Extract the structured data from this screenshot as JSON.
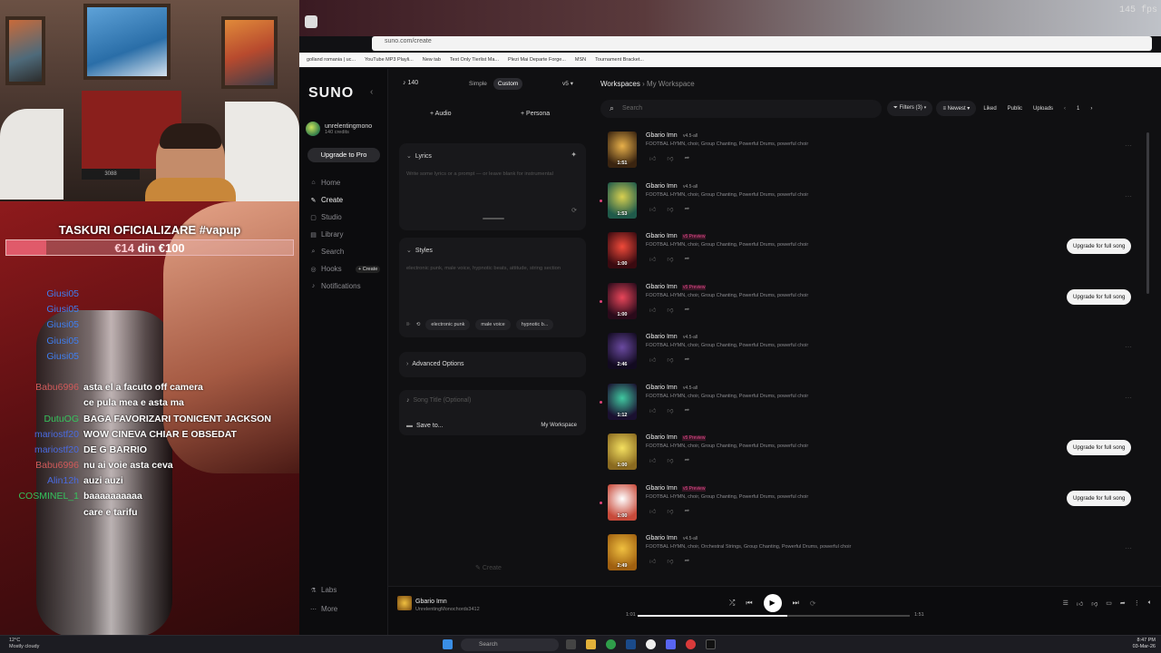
{
  "stream": {
    "goal_title": "TASKURI OFICIALIZARE #vapup",
    "goal_current": "€14",
    "goal_rest": "din €100",
    "goal_progress": 0.14,
    "chat": [
      {
        "user": "Giusi05",
        "text": "",
        "color": "#3f7ef0"
      },
      {
        "user": "Giusi05",
        "text": "",
        "color": "#3f7ef0"
      },
      {
        "user": "Giusi05",
        "text": "",
        "color": "#3f7ef0"
      },
      {
        "user": "Giusi05",
        "text": "",
        "color": "#3f7ef0"
      },
      {
        "user": "Giusi05",
        "text": "",
        "color": "#3f7ef0"
      },
      {
        "user": "",
        "text": "",
        "color": "#3f7ef0"
      },
      {
        "user": "Babu6996",
        "text": "asta el a facuto off camera",
        "color": "#d05a5a"
      },
      {
        "user": "",
        "text": "ce pula mea e asta ma",
        "color": "#d05a5a"
      },
      {
        "user": "DutuOG",
        "text": "BAGA FAVORIZARI TONICENT JACKSON",
        "color": "#35c35c"
      },
      {
        "user": "mariostf20",
        "text": "WOW CINEVA CHIAR E OBSEDAT",
        "color": "#4a6ae0"
      },
      {
        "user": "mariostf20",
        "text": "DE G BARRIO",
        "color": "#4a6ae0"
      },
      {
        "user": "Babu6996",
        "text": "nu ai voie asta ceva",
        "color": "#d05a5a"
      },
      {
        "user": "Alin12h",
        "text": "auzi auzi",
        "color": "#4a6ae0"
      },
      {
        "user": "COSMINEL_1",
        "text": "baaaaaaaaaa",
        "color": "#35c35c"
      },
      {
        "user": "",
        "text": "care e tarifu",
        "color": "#d05a5a"
      }
    ]
  },
  "browser": {
    "fps": "145 fps",
    "url": "suno.com/create",
    "bookmarks": [
      "golland romania | uc...",
      "YouTube MP3 Playli...",
      "New tab",
      "Text Only Tierlist Ma...",
      "Plezi Mai Departe Forge...",
      "MSN",
      "Tournament Bracket..."
    ]
  },
  "sidebar": {
    "logo": "SUNO",
    "collapse_icon": "chevron-left",
    "account_name": "unrelentingmono",
    "account_credits": "140 credits",
    "upgrade": "Upgrade to Pro",
    "nav": [
      {
        "label": "Home",
        "icon": "home-icon",
        "glyph": "⌂"
      },
      {
        "label": "Create",
        "icon": "create-icon",
        "glyph": "✎"
      },
      {
        "label": "Studio",
        "icon": "studio-icon",
        "glyph": "▢"
      },
      {
        "label": "Library",
        "icon": "library-icon",
        "glyph": "▤"
      },
      {
        "label": "Search",
        "icon": "search-icon",
        "glyph": "⌕"
      },
      {
        "label": "Hooks",
        "icon": "hooks-icon",
        "glyph": "◎"
      },
      {
        "label": "Notifications",
        "icon": "bell-icon",
        "glyph": "♪"
      }
    ],
    "active_nav": "Create",
    "hooks_create": "+ Create",
    "labs": "Labs",
    "more": "More"
  },
  "create": {
    "credits": "140",
    "mode_simple": "Simple",
    "mode_custom": "Custom",
    "version": "v5",
    "audio": "+ Audio",
    "persona": "+ Persona",
    "lyrics_label": "Lyrics",
    "lyrics_placeholder": "Write some lyrics or a prompt — or leave blank for instrumental",
    "styles_label": "Styles",
    "styles_placeholder": "electronic punk, male voice, hypnotic beats, attitude, string section",
    "style_tags": [
      "electronic punk",
      "male voice",
      "hypnotic b..."
    ],
    "advanced": "Advanced Options",
    "song_title_placeholder": "Song Title (Optional)",
    "save_to": "Save to...",
    "workspace": "My Workspace",
    "create_button": "Create"
  },
  "workspace": {
    "crumb_root": "Workspaces",
    "crumb_sub": "My Workspace",
    "search_placeholder": "Search",
    "filters": "Filters (3)",
    "sort": "Newest",
    "liked": "Liked",
    "public": "Public",
    "uploads": "Uploads",
    "page": "1",
    "upgrade_label": "Upgrade for full song",
    "songs": [
      {
        "title": "Gbario Imn",
        "ver": "v4.5-all",
        "preview": false,
        "desc": "FOOTBAL HYMN, choir, Group Chanting, Powerful Drums, powerful choir",
        "dur": "1:51",
        "upgrade": false,
        "dot": false,
        "c1": "#e8b04a",
        "c2": "#3a2410"
      },
      {
        "title": "Gbario Imn",
        "ver": "v4.5-all",
        "preview": false,
        "desc": "FOOTBAL HYMN, choir, Group Chanting, Powerful Drums, powerful choir",
        "dur": "1:53",
        "upgrade": false,
        "dot": true,
        "c1": "#d8d050",
        "c2": "#1f5a4a"
      },
      {
        "title": "Gbario Imn",
        "ver": "v5 Preview",
        "preview": true,
        "desc": "FOOTBAL HYMN, choir, Group Chanting, Powerful Drums, powerful choir",
        "dur": "1:00",
        "upgrade": true,
        "dot": false,
        "c1": "#f04a3a",
        "c2": "#3a0a10"
      },
      {
        "title": "Gbario Imn",
        "ver": "v5 Preview",
        "preview": true,
        "desc": "FOOTBAL HYMN, choir, Group Chanting, Powerful Drums, powerful choir",
        "dur": "1:00",
        "upgrade": true,
        "dot": true,
        "c1": "#e8465a",
        "c2": "#2a0a1a"
      },
      {
        "title": "Gbario Imn",
        "ver": "v4.5-all",
        "preview": false,
        "desc": "FOOTBAL HYMN, choir, Group Chanting, Powerful Drums, powerful choir",
        "dur": "2:46",
        "upgrade": false,
        "dot": false,
        "c1": "#6a4aa0",
        "c2": "#120a20"
      },
      {
        "title": "Gbario Imn",
        "ver": "v4.5-all",
        "preview": false,
        "desc": "FOOTBAL HYMN, choir, Group Chanting, Powerful Drums, powerful choir",
        "dur": "1:12",
        "upgrade": false,
        "dot": true,
        "c1": "#40c8a0",
        "c2": "#1a1030"
      },
      {
        "title": "Gbario Imn",
        "ver": "v5 Preview",
        "preview": true,
        "desc": "FOOTBAL HYMN, choir, Group Chanting, Powerful Drums, powerful choir",
        "dur": "1:00",
        "upgrade": true,
        "dot": false,
        "c1": "#f4e060",
        "c2": "#8a6a20"
      },
      {
        "title": "Gbario Imn",
        "ver": "v5 Preview",
        "preview": true,
        "desc": "FOOTBAL HYMN, choir, Group Chanting, Powerful Drums, powerful choir",
        "dur": "1:00",
        "upgrade": true,
        "dot": true,
        "c1": "#ffffff",
        "c2": "#c84a3a"
      },
      {
        "title": "Gbario Imn",
        "ver": "v4.5-all",
        "preview": false,
        "desc": "FOOTBAL HYMN, choir, Orchestral Strings, Group Chanting, Powerful Drums, powerful choir",
        "dur": "2:49",
        "upgrade": false,
        "dot": false,
        "c1": "#f0c040",
        "c2": "#a06010"
      }
    ]
  },
  "player": {
    "title": "Gbario Imn",
    "artist": "UnrelentingMonochords3412",
    "current": "1:01",
    "total": "1:51",
    "progress": 0.55
  },
  "taskbar": {
    "temp": "12°C",
    "weather": "Mostly cloudy",
    "search": "Search",
    "time": "8:47 PM",
    "date": "03-Mar-26"
  }
}
